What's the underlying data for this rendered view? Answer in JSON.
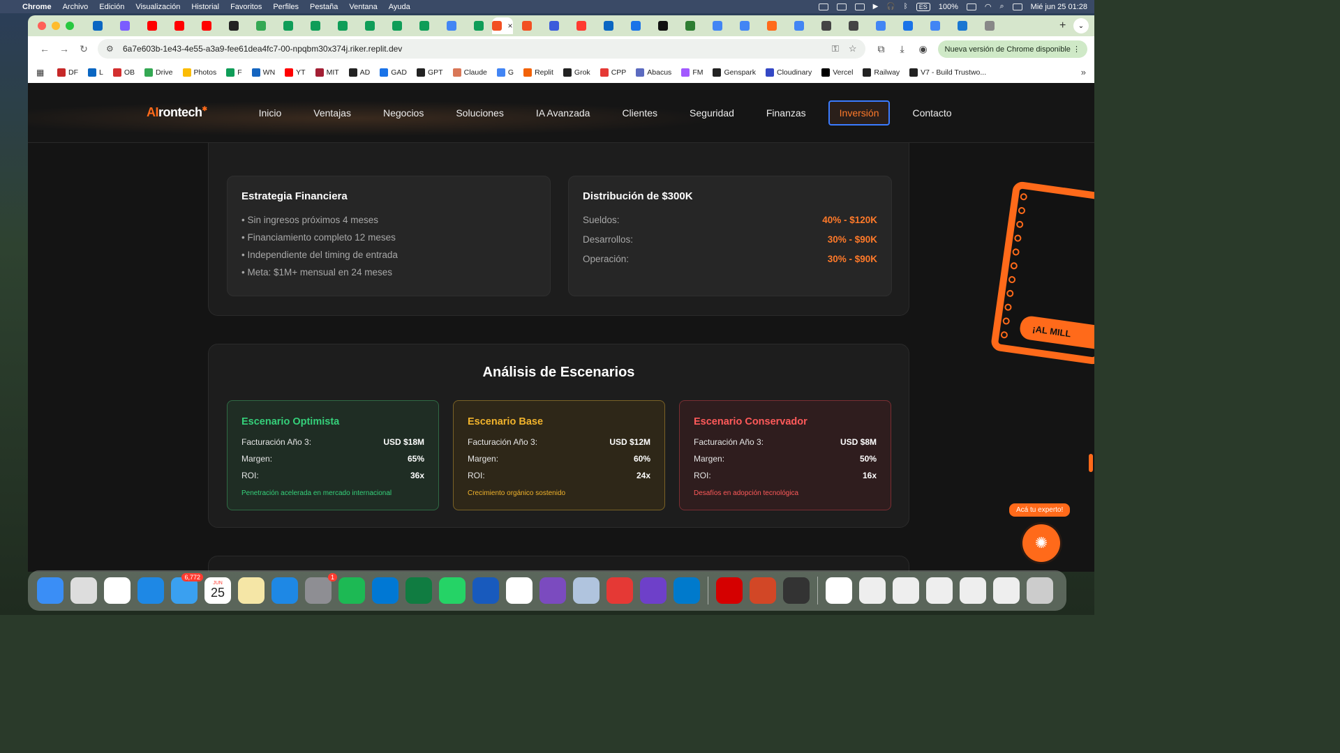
{
  "menubar": {
    "app": "Chrome",
    "items": [
      "Archivo",
      "Edición",
      "Visualización",
      "Historial",
      "Favoritos",
      "Perfiles",
      "Pestaña",
      "Ventana",
      "Ayuda"
    ],
    "battery": "100%",
    "lang": "ES",
    "datetime": "Mié jun 25  01:28"
  },
  "browser": {
    "url": "6a7e603b-1e43-4e55-a3a9-fee61dea4fc7-00-npqbm30x374j.riker.replit.dev",
    "update_label": "Nueva versión de Chrome disponible",
    "tab_colors": [
      "#0a66c2",
      "#7b5cff",
      "#ff0000",
      "#ff0000",
      "#ff0000",
      "#222",
      "#34a853",
      "#0f9d58",
      "#0f9d58",
      "#0f9d58",
      "#0f9d58",
      "#0f9d58",
      "#0f9d58",
      "#4285f4",
      "#0f9d58",
      "#f25022",
      "#f25022",
      "#3b5bdb",
      "#ff3b30",
      "#0a66c2",
      "#1a73e8",
      "#111",
      "#2e7d32",
      "#4285f4",
      "#4285f4",
      "#ff6a1a",
      "#4285f4",
      "#444",
      "#444",
      "#4285f4",
      "#1a73e8",
      "#4285f4",
      "#1976d2",
      "#888"
    ],
    "bookmarks": [
      {
        "label": "DF",
        "color": "#c62828"
      },
      {
        "label": "L",
        "color": "#0a66c2"
      },
      {
        "label": "OB",
        "color": "#d32f2f"
      },
      {
        "label": "Drive",
        "color": "#34a853"
      },
      {
        "label": "Photos",
        "color": "#fbbc04"
      },
      {
        "label": "F",
        "color": "#0f9d58"
      },
      {
        "label": "WN",
        "color": "#1565c0"
      },
      {
        "label": "YT",
        "color": "#ff0000"
      },
      {
        "label": "MIT",
        "color": "#a31f34"
      },
      {
        "label": "AD",
        "color": "#222"
      },
      {
        "label": "GAD",
        "color": "#1a73e8"
      },
      {
        "label": "GPT",
        "color": "#222"
      },
      {
        "label": "Claude",
        "color": "#d97757"
      },
      {
        "label": "G",
        "color": "#4285f4"
      },
      {
        "label": "Replit",
        "color": "#f26207"
      },
      {
        "label": "Grok",
        "color": "#222"
      },
      {
        "label": "CPP",
        "color": "#e53935"
      },
      {
        "label": "Abacus",
        "color": "#5c6bc0"
      },
      {
        "label": "FM",
        "color": "#a259ff"
      },
      {
        "label": "Genspark",
        "color": "#222"
      },
      {
        "label": "Cloudinary",
        "color": "#3448c5"
      },
      {
        "label": "Vercel",
        "color": "#000"
      },
      {
        "label": "Railway",
        "color": "#222"
      },
      {
        "label": "V7 - Build Trustwo...",
        "color": "#222"
      }
    ]
  },
  "site": {
    "logo": {
      "ai": "AI",
      "rest": "rontech"
    },
    "nav": [
      "Inicio",
      "Ventajas",
      "Negocios",
      "Soluciones",
      "IA Avanzada",
      "Clientes",
      "Seguridad",
      "Finanzas",
      "Inversión",
      "Contacto"
    ],
    "nav_active": "Inversión",
    "strategy": {
      "title": "Estrategia Financiera",
      "bullets": [
        "• Sin ingresos próximos 4 meses",
        "• Financiamiento completo 12 meses",
        "• Independiente del timing de entrada",
        "• Meta: $1M+ mensual en 24 meses"
      ]
    },
    "distribution": {
      "title": "Distribución de $300K",
      "rows": [
        {
          "label": "Sueldos:",
          "value": "40% - $120K"
        },
        {
          "label": "Desarrollos:",
          "value": "30% - $90K"
        },
        {
          "label": "Operación:",
          "value": "30% - $90K"
        }
      ]
    },
    "scenarios": {
      "title": "Análisis de Escenarios",
      "items": [
        {
          "name": "Escenario Optimista",
          "rows": [
            {
              "label": "Facturación Año 3:",
              "value": "USD $18M"
            },
            {
              "label": "Margen:",
              "value": "65%"
            },
            {
              "label": "ROI:",
              "value": "36x"
            }
          ],
          "note": "Penetración acelerada en mercado internacional"
        },
        {
          "name": "Escenario Base",
          "rows": [
            {
              "label": "Facturación Año 3:",
              "value": "USD $12M"
            },
            {
              "label": "Margen:",
              "value": "60%"
            },
            {
              "label": "ROI:",
              "value": "24x"
            }
          ],
          "note": "Crecimiento orgánico sostenido"
        },
        {
          "name": "Escenario Conservador",
          "rows": [
            {
              "label": "Facturación Año 3:",
              "value": "USD $8M"
            },
            {
              "label": "Margen:",
              "value": "50%"
            },
            {
              "label": "ROI:",
              "value": "16x"
            }
          ],
          "note": "Desafíos en adopción tecnológica"
        }
      ]
    },
    "promo_cta": "¡AL MILL",
    "expert_tag": "Acá tu experto!"
  },
  "dock": {
    "mail_badge": "6,772",
    "settings_badge": "1",
    "calendar_month": "JUN",
    "calendar_day": "25",
    "apps": [
      "finder",
      "launchpad",
      "chrome",
      "safari",
      "mail",
      "calendar",
      "notes",
      "keynote",
      "settings",
      "spotify",
      "outlook",
      "excel",
      "whatsapp",
      "word",
      "calendar31",
      "obs",
      "preview",
      "dashlane",
      "github",
      "vscode",
      "acrobat",
      "powerpoint",
      "quicktime",
      "bhp",
      "doc1",
      "doc2",
      "doc3",
      "doc4",
      "doc5",
      "trash"
    ],
    "colors": {
      "finder": "#3a8ef6",
      "launchpad": "#ddd",
      "chrome": "#fff",
      "safari": "#1e88e5",
      "mail": "#3aa0f0",
      "notes": "#f5e6a6",
      "keynote": "#1e88e5",
      "settings": "#8e8e93",
      "spotify": "#1db954",
      "outlook": "#0078d4",
      "excel": "#107c41",
      "whatsapp": "#25d366",
      "word": "#185abd",
      "calendar31": "#fff",
      "obs": "#7b4bbf",
      "preview": "#b0c4de",
      "dashlane": "#e53935",
      "github": "#6e40c9",
      "vscode": "#007acc",
      "acrobat": "#d50000",
      "powerpoint": "#d24726",
      "quicktime": "#333",
      "bhp": "#fff",
      "doc1": "#eee",
      "doc2": "#eee",
      "doc3": "#eee",
      "doc4": "#eee",
      "doc5": "#eee",
      "trash": "#ccc"
    }
  }
}
